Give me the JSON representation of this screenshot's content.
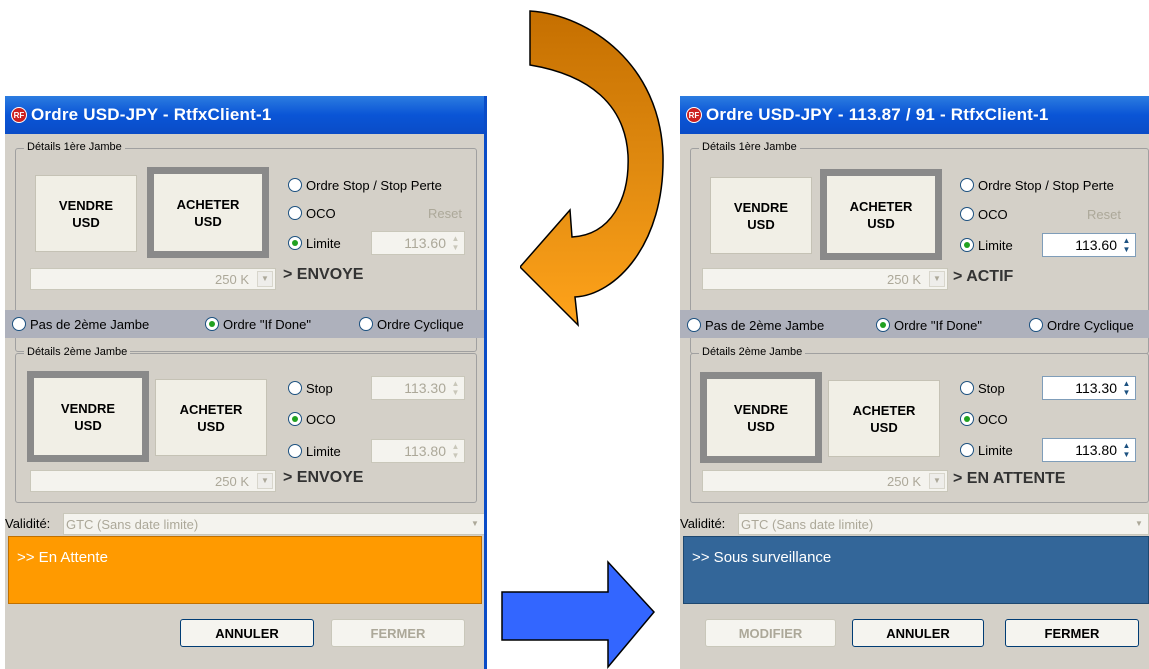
{
  "left": {
    "title": "Ordre USD-JPY - RtfxClient-1",
    "leg1": {
      "legend": "Détails 1ère Jambe",
      "sell": "VENDRE\nUSD",
      "buy": "ACHETER\nUSD",
      "opt_stop": "Ordre Stop / Stop Perte",
      "opt_oco": "OCO",
      "opt_limit": "Limite",
      "reset": "Reset",
      "limit_value": "113.60",
      "amount": "250 K",
      "status": "> ENVOYE"
    },
    "leg2_choice": {
      "none": "Pas de 2ème Jambe",
      "if_done": "Ordre \"If Done\"",
      "cyclic": "Ordre Cyclique"
    },
    "leg2": {
      "legend": "Détails 2ème Jambe",
      "sell": "VENDRE\nUSD",
      "buy": "ACHETER\nUSD",
      "opt_stop": "Stop",
      "opt_oco": "OCO",
      "opt_limit": "Limite",
      "stop_value": "113.30",
      "limit_value": "113.80",
      "amount": "250 K",
      "status": "> ENVOYE"
    },
    "validity_label": "Validité:",
    "validity_value": "GTC (Sans date limite)",
    "status_message": ">> En Attente",
    "btn_cancel": "ANNULER",
    "btn_close": "FERMER"
  },
  "right": {
    "title": "Ordre USD-JPY - 113.87 / 91 - RtfxClient-1",
    "leg1": {
      "legend": "Détails 1ère Jambe",
      "sell": "VENDRE\nUSD",
      "buy": "ACHETER\nUSD",
      "opt_stop": "Ordre Stop / Stop Perte",
      "opt_oco": "OCO",
      "opt_limit": "Limite",
      "reset": "Reset",
      "limit_value": "113.60",
      "amount": "250 K",
      "status": "> ACTIF"
    },
    "leg2_choice": {
      "none": "Pas de 2ème Jambe",
      "if_done": "Ordre \"If Done\"",
      "cyclic": "Ordre Cyclique"
    },
    "leg2": {
      "legend": "Détails 2ème Jambe",
      "sell": "VENDRE\nUSD",
      "buy": "ACHETER\nUSD",
      "opt_stop": "Stop",
      "opt_oco": "OCO",
      "opt_limit": "Limite",
      "stop_value": "113.30",
      "limit_value": "113.80",
      "amount": "250 K",
      "status": "> EN ATTENTE"
    },
    "validity_label": "Validité:",
    "validity_value": "GTC (Sans date limite)",
    "status_message": ">> Sous surveillance",
    "btn_modify": "MODIFIER",
    "btn_cancel": "ANNULER",
    "btn_close": "FERMER"
  },
  "title_icon": "RF",
  "colors": {
    "titlebar": "#0a55d6",
    "window": "#d4d0c8",
    "status_pending": "#ff9a00",
    "status_watch": "#336699",
    "curved_arrow": "#cc7700",
    "straight_arrow": "#3366ff"
  }
}
